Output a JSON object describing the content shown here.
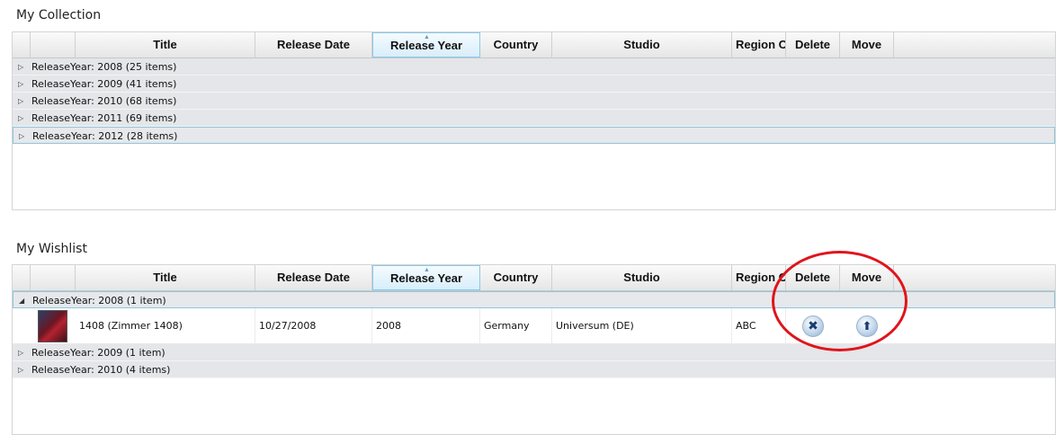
{
  "collection": {
    "title": "My Collection",
    "columns": [
      "Title",
      "Release Date",
      "Release Year",
      "Country",
      "Studio",
      "Region C",
      "Delete",
      "Move"
    ],
    "groups": [
      {
        "label": "ReleaseYear: 2008 (25 items)",
        "expanded": false
      },
      {
        "label": "ReleaseYear: 2009 (41 items)",
        "expanded": false
      },
      {
        "label": "ReleaseYear: 2010 (68 items)",
        "expanded": false
      },
      {
        "label": "ReleaseYear: 2011 (69 items)",
        "expanded": false
      },
      {
        "label": "ReleaseYear: 2012 (28 items)",
        "expanded": false,
        "selected": true
      }
    ]
  },
  "wishlist": {
    "title": "My Wishlist",
    "columns": [
      "Title",
      "Release Date",
      "Release Year",
      "Country",
      "Studio",
      "Region C",
      "Delete",
      "Move"
    ],
    "groups": [
      {
        "label": "ReleaseYear: 2008 (1 item)",
        "expanded": true
      },
      {
        "label": "ReleaseYear: 2009 (1 item)",
        "expanded": false
      },
      {
        "label": "ReleaseYear: 2010 (4 items)",
        "expanded": false
      }
    ],
    "row": {
      "title": "1408 (Zimmer 1408)",
      "release_date": "10/27/2008",
      "release_year": "2008",
      "country": "Germany",
      "studio": "Universum (DE)",
      "region": "ABC"
    }
  },
  "icons": {
    "sort": "sort-ascending-icon",
    "collapsed": "expand-triangle-icon",
    "expanded": "collapse-triangle-icon",
    "delete": "delete-x-icon",
    "move": "move-up-arrow-icon"
  },
  "colors": {
    "annotation": "#e0141b",
    "sorted_header": "#d8eefa",
    "group_row": "#e4e6e9"
  }
}
